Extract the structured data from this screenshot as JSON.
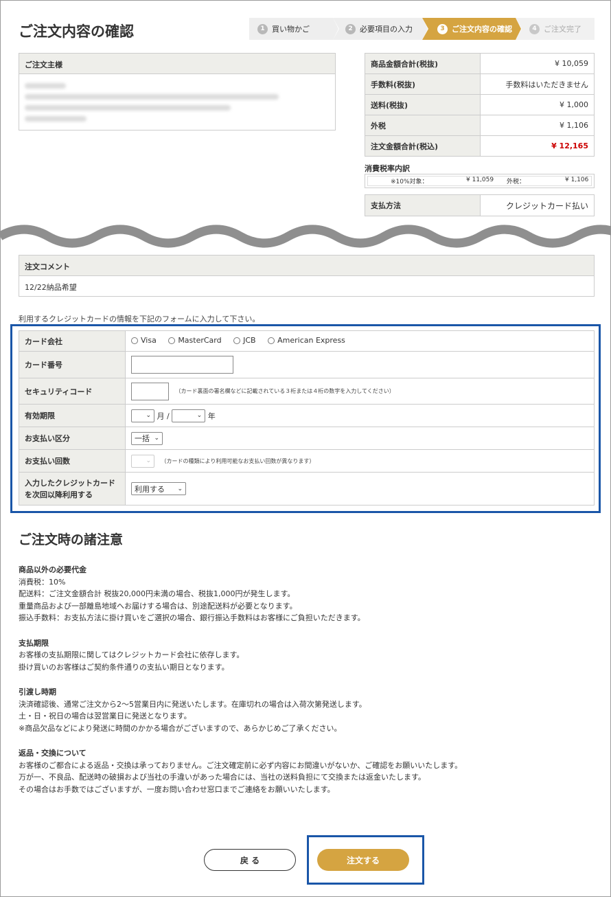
{
  "page_title": "ご注文内容の確認",
  "steps": [
    {
      "num": "1",
      "label": "買い物かご"
    },
    {
      "num": "2",
      "label": "必要項目の入力"
    },
    {
      "num": "3",
      "label": "ご注文内容の確認"
    },
    {
      "num": "4",
      "label": "ご注文完了"
    }
  ],
  "orderer": {
    "heading": "ご注文主様"
  },
  "summary": [
    {
      "label": "商品金額合計(税抜)",
      "value": "¥ 10,059"
    },
    {
      "label": "手数料(税抜)",
      "value": "手数料はいただきません"
    },
    {
      "label": "送料(税抜)",
      "value": "¥ 1,000"
    },
    {
      "label": "外税",
      "value": "¥ 1,106"
    },
    {
      "label": "注文金額合計(税込)",
      "value": "¥ 12,165"
    }
  ],
  "tax_breakdown": {
    "title": "消費税率内訳",
    "target_label": "※10%対象：",
    "target_value": "¥ 11,059",
    "tax_label": "外税：",
    "tax_value": "¥ 1,106"
  },
  "payment": {
    "label": "支払方法",
    "value": "クレジットカード払い"
  },
  "comment": {
    "heading": "注文コメント",
    "text": "12/22納品希望"
  },
  "form_intro": "利用するクレジットカードの情報を下記のフォームに入力して下さい。",
  "credit_form": {
    "card_company_label": "カード会社",
    "card_options": [
      "Visa",
      "MasterCard",
      "JCB",
      "American Express"
    ],
    "card_number_label": "カード番号",
    "card_number_value": "",
    "security_label": "セキュリティコード",
    "security_value": "",
    "security_note": "（カード裏面の署名欄などに記載されている３桁または４桁の数字を入力してください）",
    "expiry_label": "有効期限",
    "expiry_month_value": "",
    "expiry_month_unit": "月 /",
    "expiry_year_value": "",
    "expiry_year_unit": "年",
    "division_label": "お支払い区分",
    "division_value": "一括",
    "count_label": "お支払い回数",
    "count_value": "",
    "count_note": "（カードの種類により利用可能なお支払い回数が異なります）",
    "reuse_label_1": "入力したクレジットカード",
    "reuse_label_2": "を次回以降利用する",
    "reuse_value": "利用する"
  },
  "notices": {
    "title": "ご注文時の諸注意",
    "sections": [
      {
        "heading": "商品以外の必要代金",
        "lines": [
          "消費税：10%",
          "配送料：ご注文金額合計 税抜20,000円未満の場合、税抜1,000円が発生します。",
          "重量商品および一部離島地域へお届けする場合は、別途配送料が必要となります。",
          "振込手数料：お支払方法に掛け買いをご選択の場合、銀行振込手数料はお客様にご負担いただきます。"
        ]
      },
      {
        "heading": "支払期限",
        "lines": [
          "お客様の支払期限に関してはクレジットカード会社に依存します。",
          "掛け買いのお客様はご契約条件通りの支払い期日となります。"
        ]
      },
      {
        "heading": "引渡し時期",
        "lines": [
          "決済確認後、通常ご注文から2〜5営業日内に発送いたします。在庫切れの場合は入荷次第発送します。",
          "土・日・祝日の場合は翌営業日に発送となります。",
          "※商品欠品などにより発送に時間のかかる場合がございますので、あらかじめご了承ください。"
        ]
      },
      {
        "heading": "返品・交換について",
        "lines": [
          "お客様のご都合による返品・交換は承っておりません。ご注文確定前に必ず内容にお間違いがないか、ご確認をお願いいたします。",
          "万が一、不良品、配送時の破損および当社の手違いがあった場合には、当社の送料負担にて交換または返金いたします。",
          "その場合はお手数ではございますが、一度お問い合わせ窓口までご連絡をお願いいたします。"
        ]
      }
    ]
  },
  "buttons": {
    "back": "戻 る",
    "order": "注文する"
  },
  "colors": {
    "accent": "#d5a441",
    "highlight": "#1a56a8",
    "total_red": "#cc0000"
  }
}
